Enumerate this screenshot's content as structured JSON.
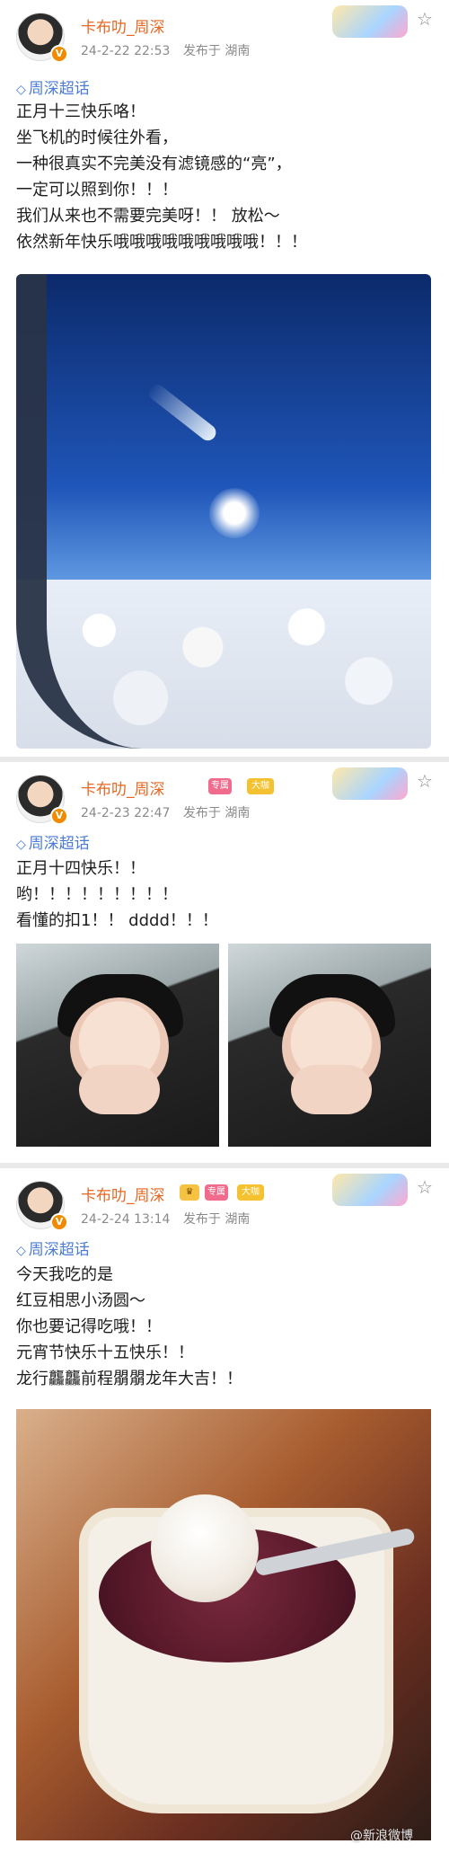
{
  "posts": [
    {
      "username": "卡布叻_周深",
      "date": "24-2-22 22:53",
      "source": "发布于 湖南",
      "topic": "周深超话",
      "lines": [
        "正月十三快乐咯！",
        "坐飞机的时候往外看，",
        "一种很真实不完美没有滤镜感的“亮”，",
        "一定可以照到你！！！",
        "我们从来也不需要完美呀！！ 放松～",
        "依然新年快乐哦哦哦哦哦哦哦哦哦！！！"
      ]
    },
    {
      "username": "卡布叻_周深",
      "date": "24-2-23 22:47",
      "source": "发布于 湖南",
      "topic": "周深超话",
      "lines": [
        "正月十四快乐！！",
        "哟！！！！！！！！！",
        "看懂的扣1！！ dddd！！！"
      ]
    },
    {
      "username": "卡布叻_周深",
      "date": "24-2-24 13:14",
      "source": "发布于 湖南",
      "topic": "周深超话",
      "lines": [
        "今天我吃的是",
        "红豆相思小汤圆～",
        "你也要记得吃哦！！",
        "元宵节快乐十五快乐！！",
        "龙行龘龘前程朤朤龙年大吉！！"
      ]
    }
  ],
  "badges": {
    "pro": "专属",
    "level": "大咖"
  },
  "watermark": "@新浪微博"
}
